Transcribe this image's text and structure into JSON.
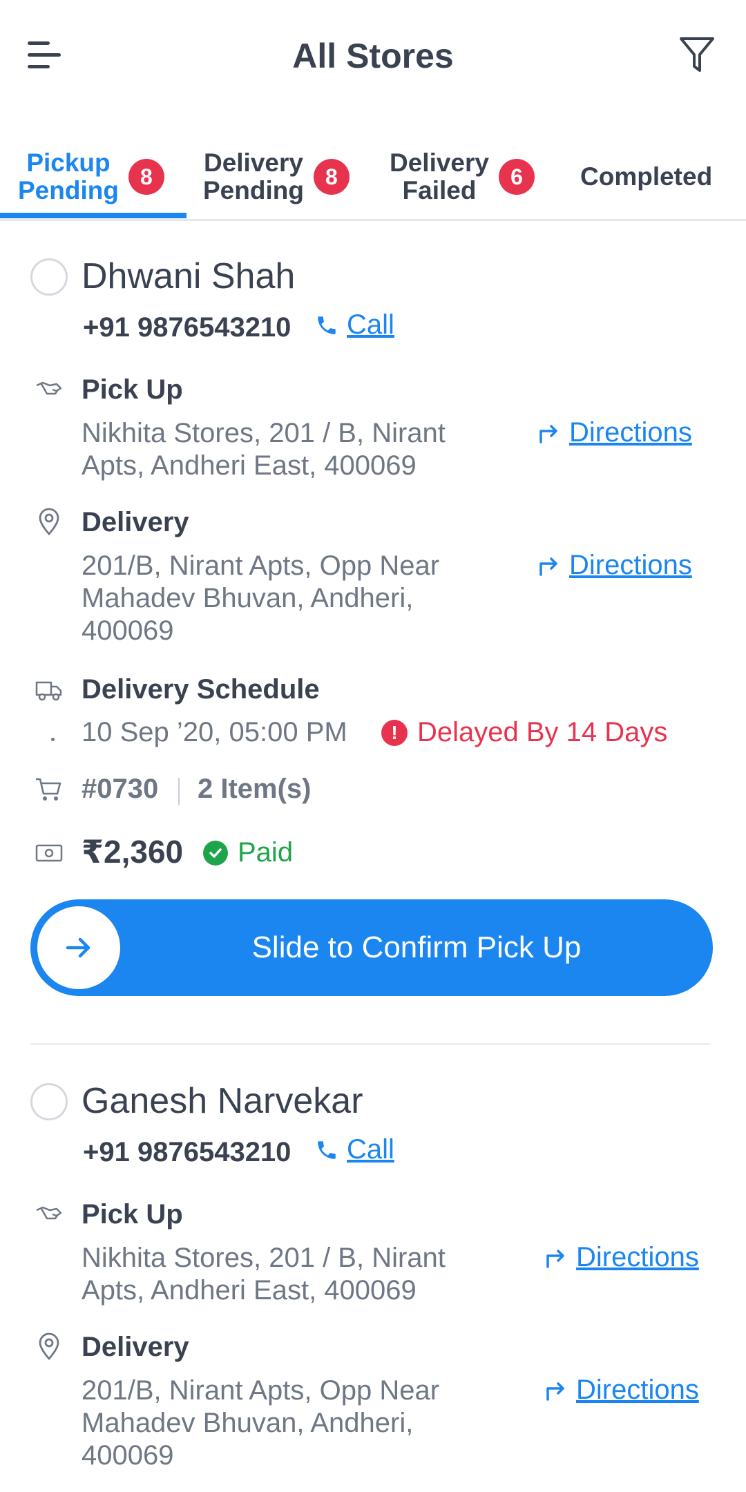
{
  "header": {
    "title": "All Stores",
    "menu_icon": "menu-icon",
    "filter_icon": "filter-icon"
  },
  "tabs": [
    {
      "label": "Pickup\nPending",
      "badge": "8",
      "active": true
    },
    {
      "label": "Delivery\nPending",
      "badge": "8",
      "active": false
    },
    {
      "label": "Delivery\nFailed",
      "badge": "6",
      "active": false
    },
    {
      "label": "Completed",
      "badge": null,
      "active": false
    }
  ],
  "colors": {
    "accent": "#1b86f0",
    "badge": "#e8334f",
    "paid": "#1ea44a",
    "text": "#3a4150",
    "muted": "#6f7785"
  },
  "orders": [
    {
      "name": "Dhwani Shah",
      "phone": "+91 9876543210",
      "call_label": "Call",
      "pickup_label": "Pick Up",
      "pickup_address": "Nikhita Stores, 201 / B, Nirant Apts, Andheri East, 400069",
      "directions_label": "Directions",
      "delivery_label": "Delivery",
      "delivery_address": "201/B, Nirant Apts, Opp Near Mahadev Bhuvan, Andheri, 400069",
      "schedule_label": "Delivery Schedule",
      "schedule_time": "10 Sep ’20, 05:00 PM",
      "delay_text": "Delayed By 14 Days",
      "order_no": "#0730",
      "items": "2 Item(s)",
      "amount": "₹2,360",
      "payment_status": "Paid",
      "slide_label": "Slide to Confirm Pick Up"
    },
    {
      "name": "Ganesh Narvekar",
      "phone": "+91 9876543210",
      "call_label": "Call",
      "pickup_label": "Pick Up",
      "pickup_address": "Nikhita Stores, 201 / B, Nirant Apts, Andheri East, 400069",
      "directions_label": "Directions",
      "delivery_label": "Delivery",
      "delivery_address": "201/B, Nirant Apts, Opp Near Mahadev Bhuvan, Andheri, 400069"
    }
  ]
}
